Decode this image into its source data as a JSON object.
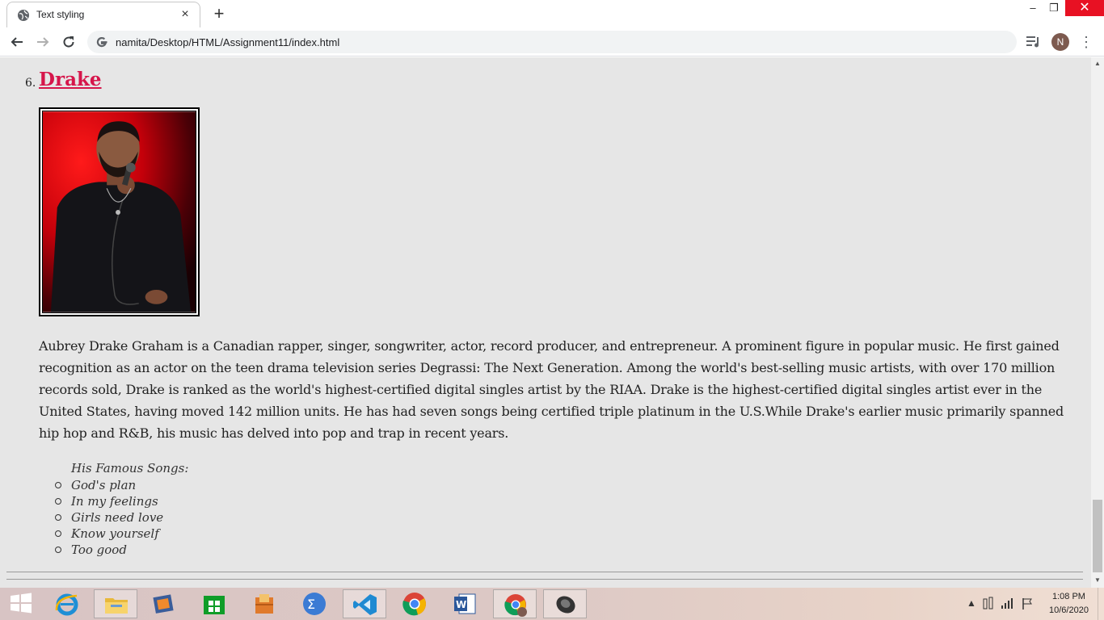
{
  "browser": {
    "tab_title": "Text styling",
    "tab_close": "×",
    "new_tab": "+",
    "url": "namita/Desktop/HTML/Assignment11/index.html",
    "profile_initial": "N",
    "window_min": "–",
    "window_max": "❐",
    "window_close": "✕",
    "icons": [
      "globe-icon",
      "back-icon",
      "forward-icon",
      "reload-icon",
      "google-g-icon",
      "media-control-icon",
      "menu-icon"
    ]
  },
  "page": {
    "item_number": "6.",
    "artist_name": "Drake",
    "bio": "Aubrey Drake Graham is a Canadian rapper, singer, songwriter, actor, record producer, and entrepreneur. A prominent figure in popular music. He first gained recognition as an actor on the teen drama television series Degrassi: The Next Generation. Among the world's best-selling music artists, with over 170 million records sold, Drake is ranked as the world's highest-certified digital singles artist by the RIAA. Drake is the highest-certified digital singles artist ever in the United States, having moved 142 million units. He has had seven songs being certified triple platinum in the U.S.While Drake's earlier music primarily spanned hip hop and R&B, his music has delved into pop and trap in recent years.",
    "songs_heading": "His Famous Songs:",
    "songs": [
      "God's plan",
      "In my feelings",
      "Girls need love",
      "Know yourself",
      "Too good"
    ],
    "link_color": "#d6164b",
    "background_color": "#e6e6e6"
  },
  "taskbar": {
    "apps": [
      "start-button",
      "internet-explorer-icon",
      "file-explorer-icon",
      "media-player-icon",
      "store-icon",
      "package-icon",
      "math-input-icon",
      "vscode-icon",
      "chrome-icon",
      "word-icon",
      "chrome-profile-icon",
      "speaker-app-icon"
    ],
    "clock_time": "1:08 PM",
    "clock_date": "10/6/2020"
  }
}
